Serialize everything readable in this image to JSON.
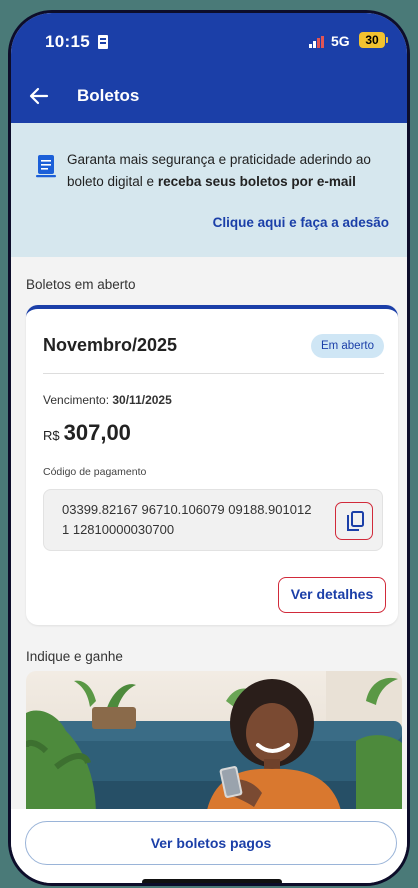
{
  "status_bar": {
    "time": "10:15",
    "network": "5G",
    "battery": "30"
  },
  "app_bar": {
    "title": "Boletos",
    "back_icon": "arrow-left-icon"
  },
  "banner": {
    "text_before": "Garanta mais segurança e praticidade aderindo ao boleto digital e ",
    "text_bold": "receba seus boletos por e-mail",
    "link": "Clique aqui e faça a adesão",
    "icon": "document-icon"
  },
  "open_section": {
    "title": "Boletos em aberto"
  },
  "boleto": {
    "month": "Novembro/2025",
    "status": "Em aberto",
    "due_label": "Vencimento: ",
    "due_date": "30/11/2025",
    "currency": "R$",
    "amount": "307,00",
    "code_label": "Código de pagamento",
    "code": "03399.82167 96710.106079 09188.901012 1 12810000030700",
    "copy_icon": "copy-icon",
    "details_button": "Ver detalhes"
  },
  "promo_section": {
    "title": "Indique e ganhe"
  },
  "bottom": {
    "paid_button": "Ver boletos pagos"
  },
  "colors": {
    "brand": "#1b3fa8",
    "banner_bg": "#d6e7ee",
    "badge_bg": "#cfe6f5",
    "highlight": "#d12a3a"
  }
}
